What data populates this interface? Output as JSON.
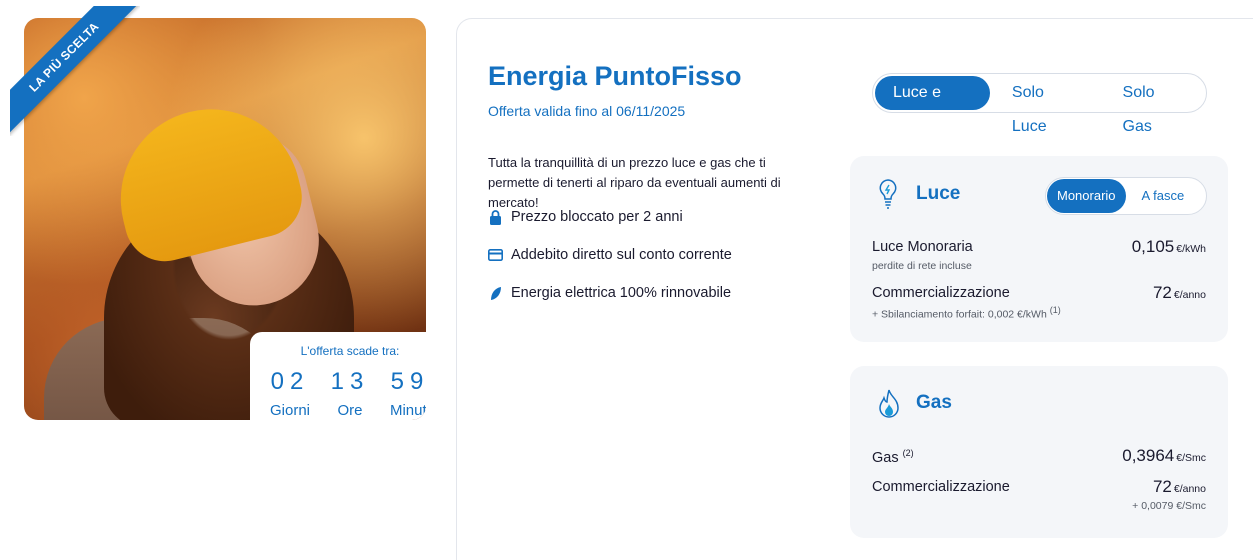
{
  "hero": {
    "ribbon": "LA PIÙ SCELTA",
    "countdown": {
      "label": "L'offerta scade tra:",
      "days": "02",
      "days_label": "Giorni",
      "hours": "13",
      "hours_label": "Ore",
      "minutes": "59",
      "minutes_label": "Minuti"
    }
  },
  "offer": {
    "title": "Energia PuntoFisso",
    "valid_until": "Offerta valida fino al 06/11/2025",
    "description": "Tutta la tranquillità di un prezzo luce e gas che ti permette di tenerti al riparo da eventuali aumenti di mercato!",
    "features": [
      {
        "icon": "lock-icon",
        "label": "Prezzo bloccato per 2 anni"
      },
      {
        "icon": "credit-card-icon",
        "label": "Addebito diretto sul conto corrente"
      },
      {
        "icon": "leaf-icon",
        "label": "Energia elettrica 100% rinnovabile"
      }
    ]
  },
  "supply_tabs": {
    "options": [
      "Luce e Gas",
      "Solo Luce",
      "Solo Gas"
    ],
    "selected": "Luce e Gas"
  },
  "luce": {
    "title": "Luce",
    "icon": "lightbulb-icon",
    "tariff_tabs": {
      "options": [
        "Monorario",
        "A fasce"
      ],
      "selected": "Monorario"
    },
    "rows": [
      {
        "label": "Luce Monoraria",
        "sub": "perdite di rete incluse",
        "value": "0,105",
        "unit": "€/kWh"
      },
      {
        "label": "Commercializzazione",
        "sub": "+ Sbilanciamento forfait: 0,002 €/kWh",
        "sub_note": "(1)",
        "value": "72",
        "unit": "€/anno"
      }
    ]
  },
  "gas": {
    "title": "Gas",
    "icon": "flame-icon",
    "rows": [
      {
        "label": "Gas",
        "note": "(2)",
        "value": "0,3964",
        "unit": "€/Smc"
      },
      {
        "label": "Commercializzazione",
        "value": "72",
        "unit": "€/anno",
        "extra": "+ 0,0079 €/Smc"
      }
    ]
  },
  "colors": {
    "accent": "#1470c0",
    "card_bg": "#f4f6f9"
  }
}
